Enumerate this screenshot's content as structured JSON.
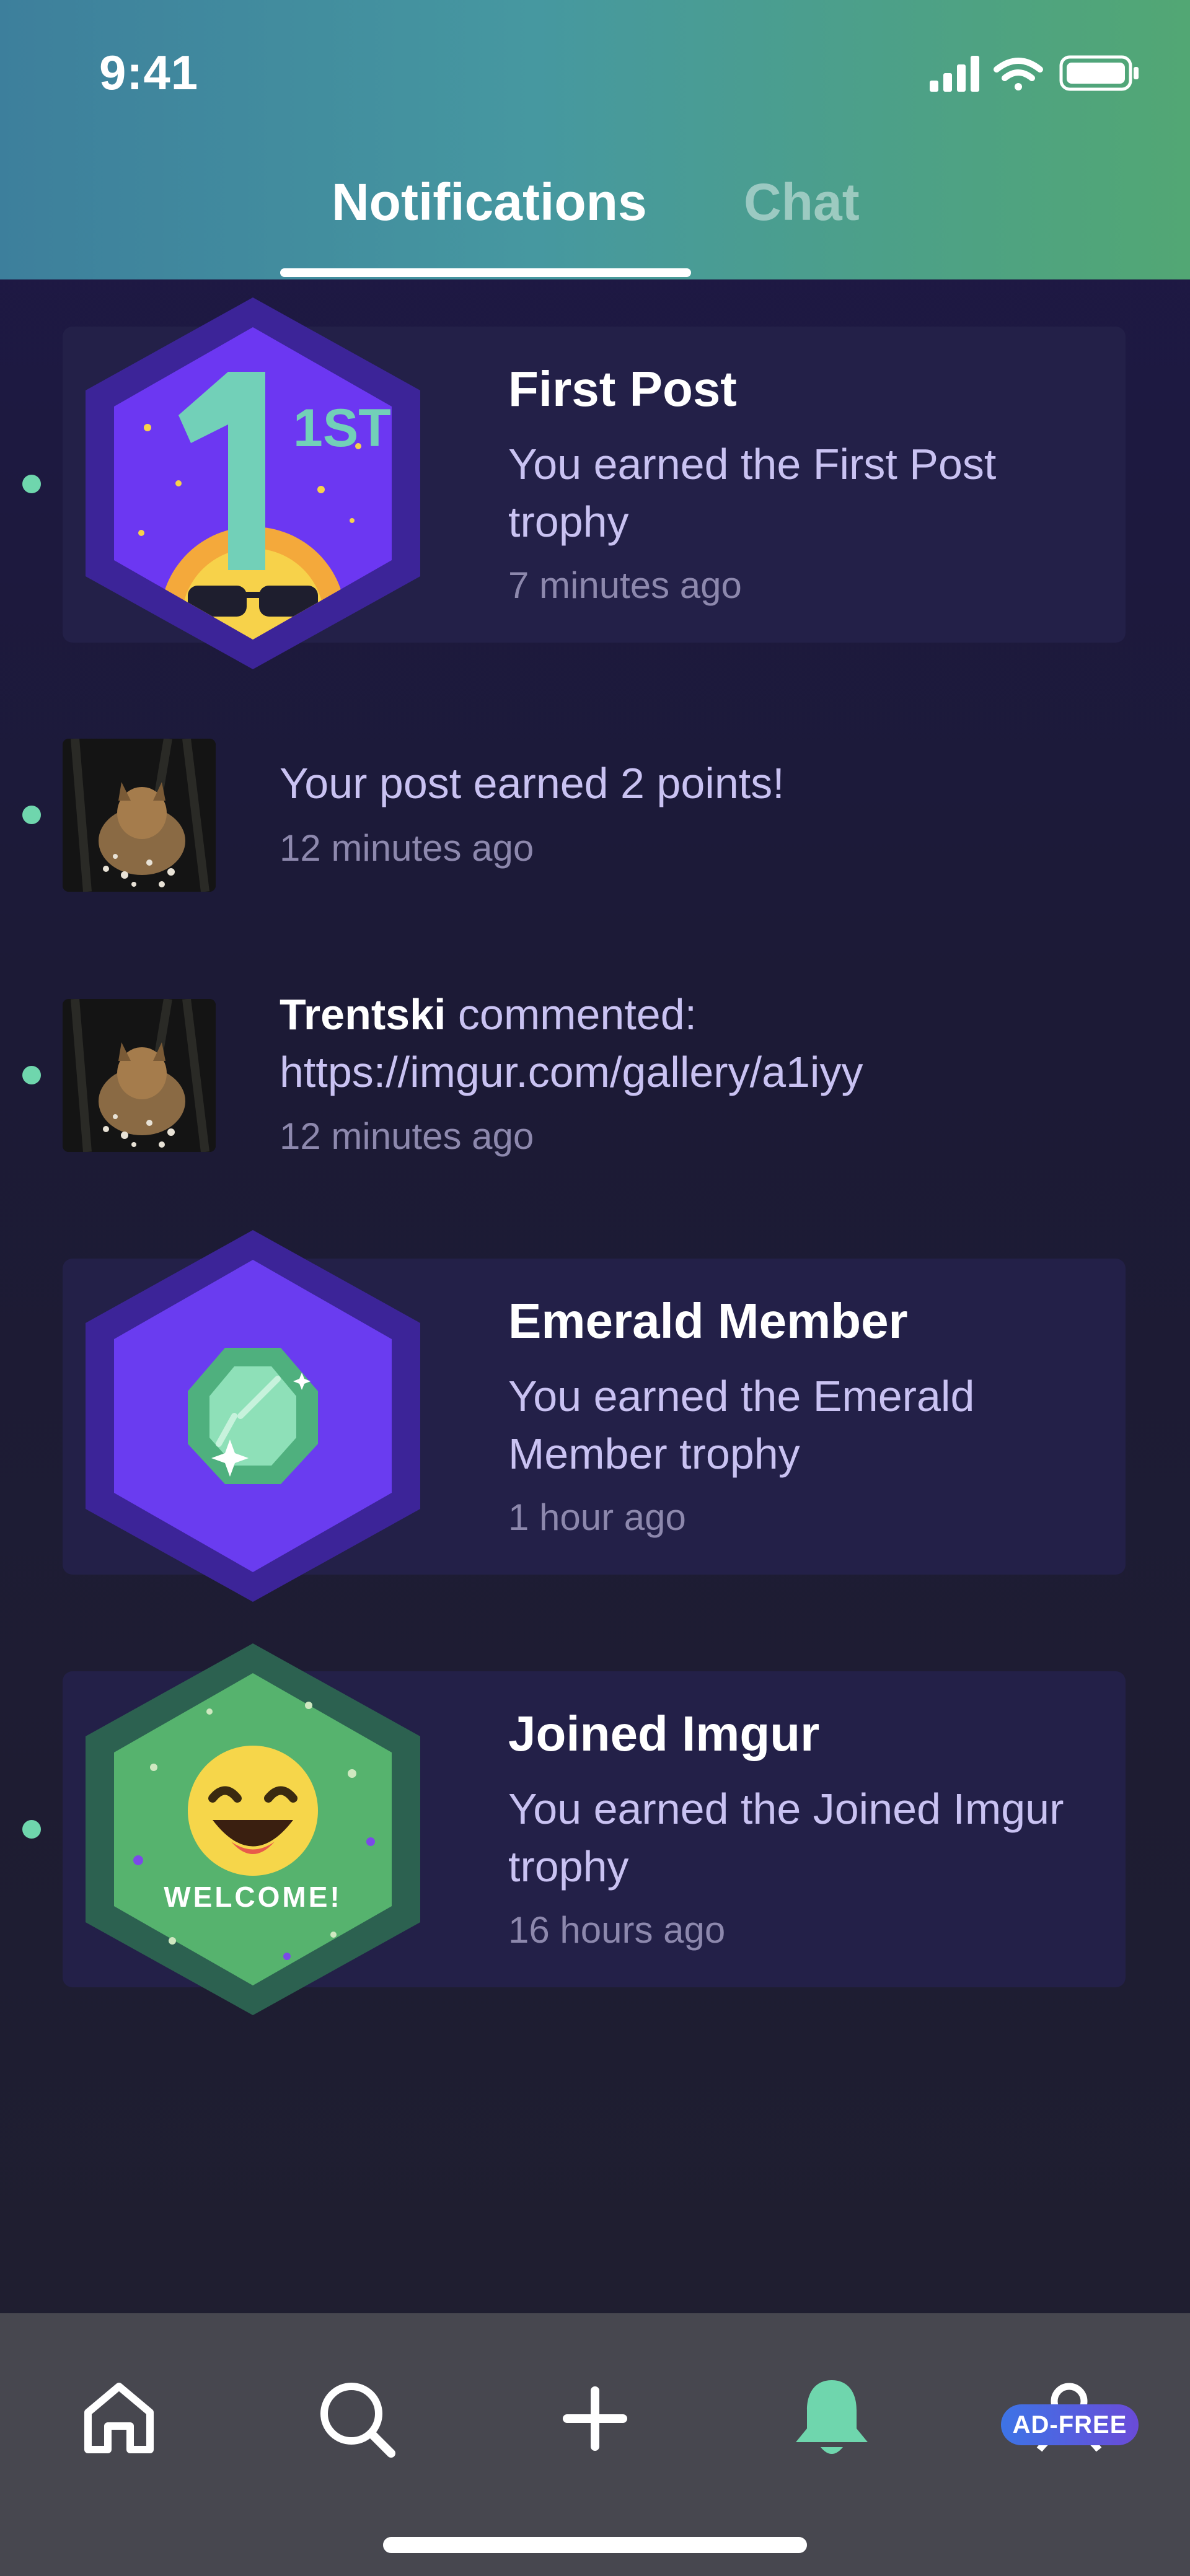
{
  "status_bar": {
    "time": "9:41"
  },
  "tabs": [
    {
      "label": "Notifications",
      "active": true
    },
    {
      "label": "Chat",
      "active": false
    }
  ],
  "notifications": [
    {
      "kind": "trophy",
      "unread": true,
      "badge": "first-post-badge",
      "badge_text": "1ST",
      "title": "First Post",
      "description": "You earned the First Post trophy",
      "time": "7 minutes ago"
    },
    {
      "kind": "post",
      "unread": true,
      "text": "Your post earned 2 points!",
      "time": "12 minutes ago"
    },
    {
      "kind": "comment",
      "unread": true,
      "user": "Trentski",
      "text": " commented: https://imgur.com/gallery/a1iyy",
      "time": "12 minutes ago"
    },
    {
      "kind": "trophy",
      "unread": false,
      "badge": "emerald-badge",
      "title": "Emerald Member",
      "description": "You earned the Emerald Member trophy",
      "time": "1 hour ago"
    },
    {
      "kind": "trophy",
      "unread": true,
      "badge": "welcome-badge",
      "badge_text": "WELCOME!",
      "title": "Joined Imgur",
      "description": "You earned the Joined Imgur trophy",
      "time": "16 hours ago"
    }
  ],
  "bottom_nav": {
    "items": [
      {
        "name": "home",
        "icon": "home-icon"
      },
      {
        "name": "search",
        "icon": "search-icon"
      },
      {
        "name": "create",
        "icon": "plus-icon"
      },
      {
        "name": "notifications",
        "icon": "bell-icon",
        "active": true
      },
      {
        "name": "profile",
        "icon": "user-icon"
      }
    ],
    "ad_free_label": "AD-FREE"
  },
  "colors": {
    "accent": "#6fd6ad",
    "card": "#232048",
    "background": "#1c1a33",
    "header_start": "#3d7f9c",
    "header_end": "#52a774"
  }
}
